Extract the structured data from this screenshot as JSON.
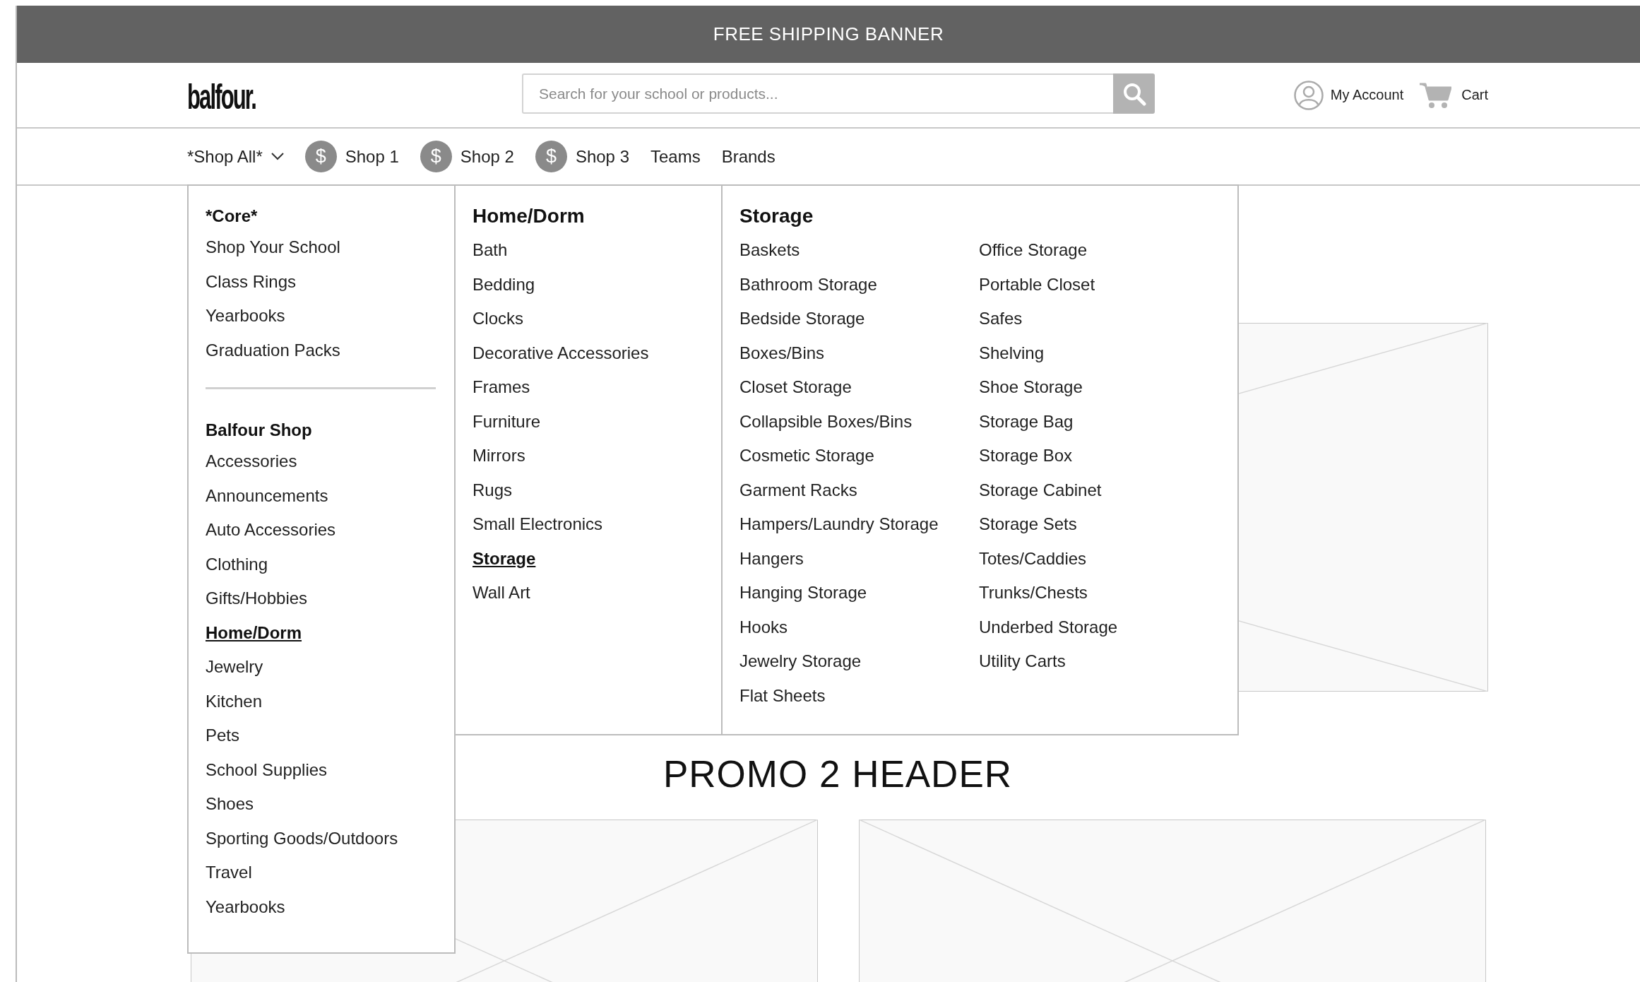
{
  "banner": {
    "text": "FREE SHIPPING BANNER"
  },
  "header": {
    "logo": "balfour.",
    "search": {
      "placeholder": "Search for your school or products..."
    },
    "account": {
      "label": "My Account"
    },
    "cart": {
      "label": "Cart"
    }
  },
  "nav": {
    "items": [
      {
        "label": "*Shop All*",
        "kind": "dropdown"
      },
      {
        "label": "Shop 1",
        "kind": "shop",
        "icon_text": "$"
      },
      {
        "label": "Shop 2",
        "kind": "shop",
        "icon_text": "$"
      },
      {
        "label": "Shop 3",
        "kind": "shop",
        "icon_text": "$"
      },
      {
        "label": "Teams",
        "kind": "plain"
      },
      {
        "label": "Brands",
        "kind": "plain"
      }
    ]
  },
  "mega_menu": {
    "columns": [
      {
        "sections": [
          {
            "heading": "*Core*",
            "items": [
              {
                "label": "Shop Your School",
                "selected": false
              },
              {
                "label": "Class Rings",
                "selected": false
              },
              {
                "label": "Yearbooks",
                "selected": false
              },
              {
                "label": "Graduation Packs",
                "selected": false
              }
            ]
          },
          {
            "heading": "Balfour Shop",
            "items": [
              {
                "label": "Accessories",
                "selected": false
              },
              {
                "label": "Announcements",
                "selected": false
              },
              {
                "label": "Auto Accessories",
                "selected": false
              },
              {
                "label": "Clothing",
                "selected": false
              },
              {
                "label": "Gifts/Hobbies",
                "selected": false
              },
              {
                "label": "Home/Dorm",
                "selected": true
              },
              {
                "label": "Jewelry",
                "selected": false
              },
              {
                "label": "Kitchen",
                "selected": false
              },
              {
                "label": "Pets",
                "selected": false
              },
              {
                "label": "School Supplies",
                "selected": false
              },
              {
                "label": "Shoes",
                "selected": false
              },
              {
                "label": "Sporting Goods/Outdoors",
                "selected": false
              },
              {
                "label": "Travel",
                "selected": false
              },
              {
                "label": "Yearbooks",
                "selected": false
              }
            ]
          }
        ]
      },
      {
        "sections": [
          {
            "heading": "Home/Dorm",
            "items": [
              {
                "label": "Bath",
                "selected": false
              },
              {
                "label": "Bedding",
                "selected": false
              },
              {
                "label": "Clocks",
                "selected": false
              },
              {
                "label": "Decorative Accessories",
                "selected": false
              },
              {
                "label": "Frames",
                "selected": false
              },
              {
                "label": "Furniture",
                "selected": false
              },
              {
                "label": "Mirrors",
                "selected": false
              },
              {
                "label": "Rugs",
                "selected": false
              },
              {
                "label": "Small Electronics",
                "selected": false
              },
              {
                "label": "Storage",
                "selected": true
              },
              {
                "label": "Wall Art",
                "selected": false
              }
            ]
          }
        ]
      },
      {
        "sections": [
          {
            "heading": "Storage",
            "item_columns": [
              [
                {
                  "label": "Baskets",
                  "selected": false
                },
                {
                  "label": "Bathroom Storage",
                  "selected": false
                },
                {
                  "label": "Bedside Storage",
                  "selected": false
                },
                {
                  "label": "Boxes/Bins",
                  "selected": false
                },
                {
                  "label": "Closet Storage",
                  "selected": false
                },
                {
                  "label": "Collapsible Boxes/Bins",
                  "selected": false
                },
                {
                  "label": "Cosmetic Storage",
                  "selected": false
                },
                {
                  "label": "Garment Racks",
                  "selected": false
                },
                {
                  "label": "Hampers/Laundry Storage",
                  "selected": false
                },
                {
                  "label": "Hangers",
                  "selected": false
                },
                {
                  "label": "Hanging Storage",
                  "selected": false
                },
                {
                  "label": "Hooks",
                  "selected": false
                },
                {
                  "label": "Jewelry Storage",
                  "selected": false
                },
                {
                  "label": "Flat Sheets",
                  "selected": false
                }
              ],
              [
                {
                  "label": "Office Storage",
                  "selected": false
                },
                {
                  "label": "Portable Closet",
                  "selected": false
                },
                {
                  "label": "Safes",
                  "selected": false
                },
                {
                  "label": "Shelving",
                  "selected": false
                },
                {
                  "label": "Shoe Storage",
                  "selected": false
                },
                {
                  "label": "Storage Bag",
                  "selected": false
                },
                {
                  "label": "Storage Box",
                  "selected": false
                },
                {
                  "label": "Storage Cabinet",
                  "selected": false
                },
                {
                  "label": "Storage Sets",
                  "selected": false
                },
                {
                  "label": "Totes/Caddies",
                  "selected": false
                },
                {
                  "label": "Trunks/Chests",
                  "selected": false
                },
                {
                  "label": "Underbed Storage",
                  "selected": false
                },
                {
                  "label": "Utility Carts",
                  "selected": false
                }
              ]
            ]
          }
        ]
      }
    ]
  },
  "promo": {
    "header": "PROMO 2 HEADER"
  }
}
